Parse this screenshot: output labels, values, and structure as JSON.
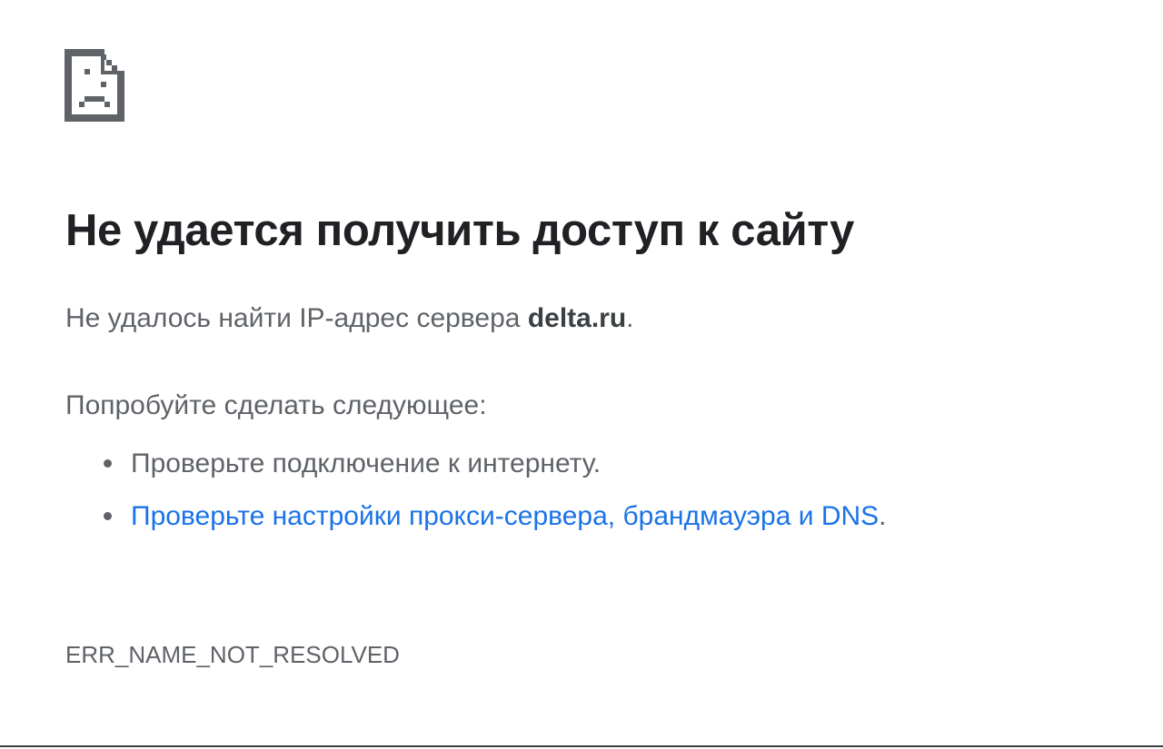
{
  "error_page": {
    "icon": "broken-page-sad-icon",
    "title": "Не удается получить доступ к сайту",
    "summary_prefix": "Не удалось найти IP-адрес сервера ",
    "host": "delta.ru",
    "summary_suffix": ".",
    "suggestions_heading": "Попробуйте сделать следующее:",
    "suggestions": [
      {
        "text": "Проверьте подключение к интернету."
      },
      {
        "link_text": "Проверьте настройки прокси-сервера, брандмауэра и DNS",
        "suffix": "."
      }
    ],
    "error_code": "ERR_NAME_NOT_RESOLVED"
  },
  "colors": {
    "title": "#202124",
    "body_text": "#5f6368",
    "link": "#1a73e8",
    "icon": "#5f6368"
  }
}
